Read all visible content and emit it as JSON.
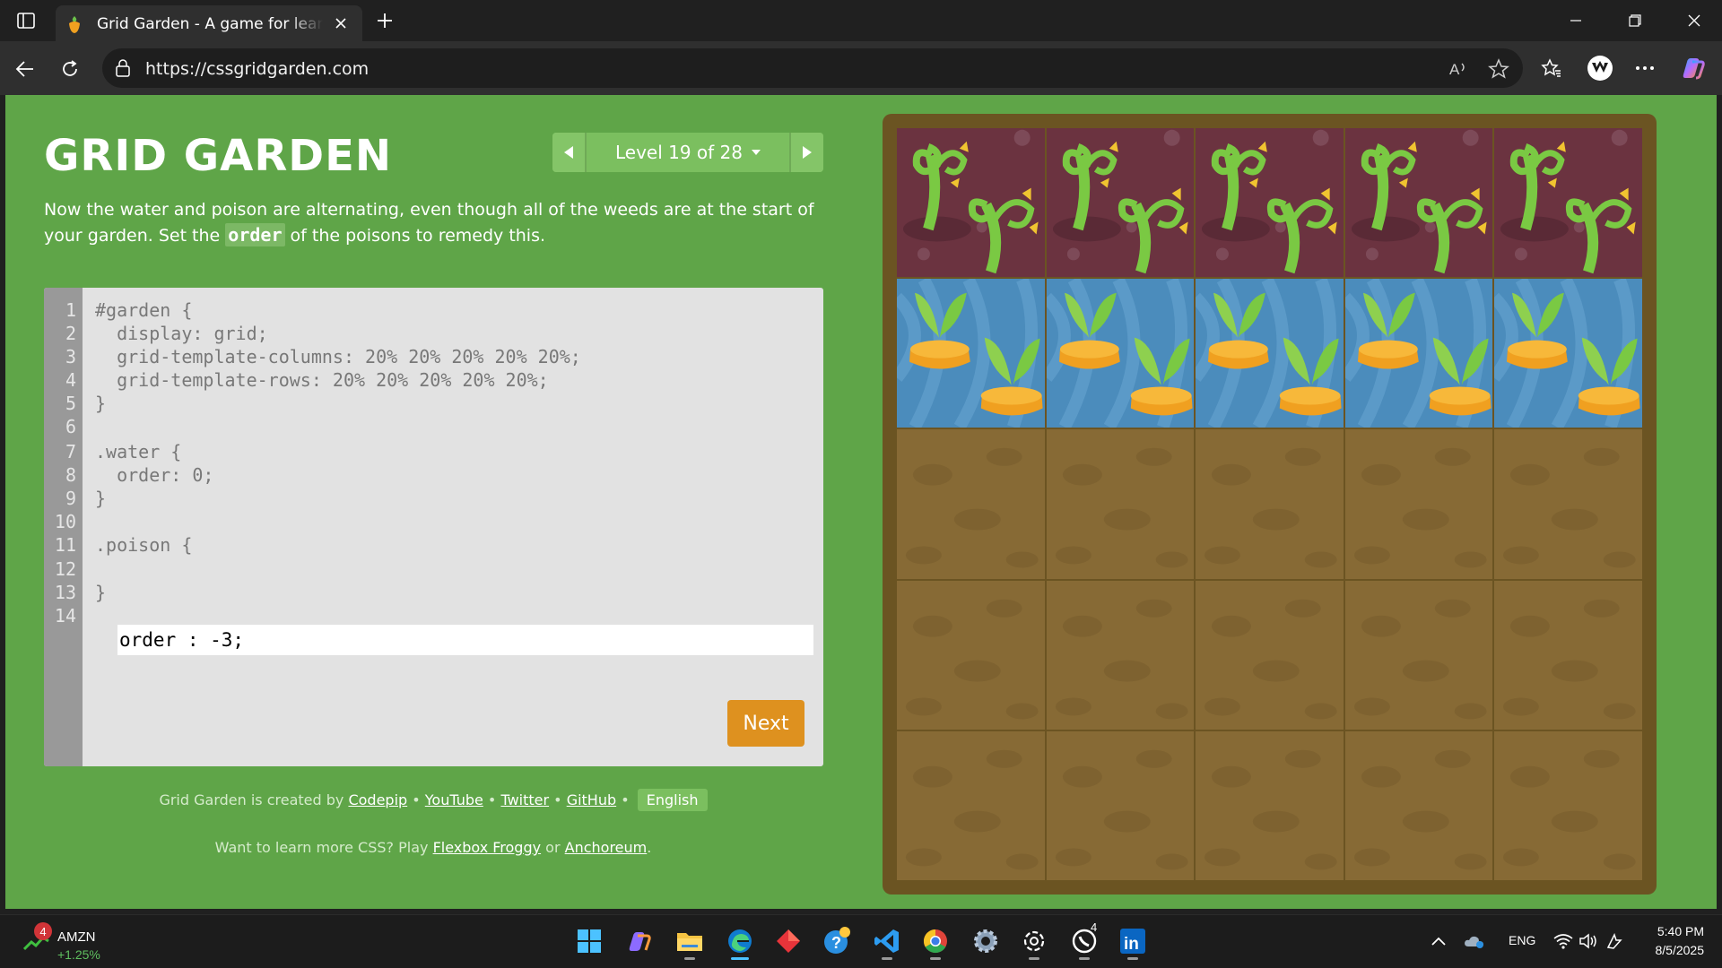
{
  "browser": {
    "tab_title": "Grid Garden - A game for learning CSS grid",
    "url": "https://cssgridgarden.com",
    "icons": [
      "tab-actions-icon",
      "close-icon",
      "plus-icon",
      "minimize-icon",
      "restore-icon",
      "back-icon",
      "refresh-icon",
      "lock-icon",
      "read-aloud-icon",
      "favorite-star-icon",
      "favorites-icon",
      "extension-icon",
      "more-icon",
      "copilot-icon"
    ]
  },
  "page": {
    "title": "GRID GARDEN",
    "level_text": "Level 19 of 28",
    "instructions": {
      "before": "Now the water and poison are alternating, even though all of the weeds are at the start of your garden. Set the ",
      "keyword": "order",
      "after": " of the poisons to remedy this."
    },
    "line_numbers": [
      "1",
      "2",
      "3",
      "4",
      "5",
      "6",
      "7",
      "8",
      "9",
      "10",
      "11",
      "12",
      "13",
      "14"
    ],
    "code_lines": [
      "#garden {",
      "  display: grid;",
      "  grid-template-columns: 20% 20% 20% 20% 20%;",
      "  grid-template-rows: 20% 20% 20% 20% 20%;",
      "}",
      "",
      ".water {",
      "  order: 0;",
      "}",
      "",
      ".poison {",
      "",
      "}",
      ""
    ],
    "input_value": "order : -3;",
    "next_label": "Next",
    "footer": {
      "credit_prefix": "Grid Garden is created by ",
      "links": [
        "Codepip",
        "YouTube",
        "Twitter",
        "GitHub"
      ],
      "separator": " • ",
      "language": "English",
      "more_prefix": "Want to learn more CSS? Play ",
      "more_link1": "Flexbox Froggy",
      "more_or": " or ",
      "more_link2": "Anchoreum",
      "more_suffix": "."
    },
    "garden": {
      "rows": [
        [
          "poison",
          "poison",
          "poison",
          "poison",
          "poison"
        ],
        [
          "water",
          "water",
          "water",
          "water",
          "water"
        ],
        [
          "dirt",
          "dirt",
          "dirt",
          "dirt",
          "dirt"
        ],
        [
          "dirt",
          "dirt",
          "dirt",
          "dirt",
          "dirt"
        ],
        [
          "dirt",
          "dirt",
          "dirt",
          "dirt",
          "dirt"
        ]
      ]
    },
    "colors": {
      "background": "#5fa548",
      "next_button": "#de911f",
      "garden_frame": "#6b5422",
      "dirt": "#876a35",
      "poison_bg": "#6b3340",
      "water_bg": "#4b8cbc"
    }
  },
  "taskbar": {
    "stock_badge": "4",
    "stock_symbol": "AMZN",
    "stock_change": "+1.25%",
    "whatsapp_badge": "4",
    "apps": [
      "start-icon",
      "copilot-app-icon",
      "file-explorer-icon",
      "edge-icon",
      "app-red-icon",
      "help-icon",
      "vscode-icon",
      "chrome-icon",
      "settings-icon",
      "chatgpt-icon",
      "whatsapp-icon",
      "linkedin-icon"
    ],
    "language": "ENG",
    "time": "5:40 PM",
    "date": "8/5/2025"
  }
}
